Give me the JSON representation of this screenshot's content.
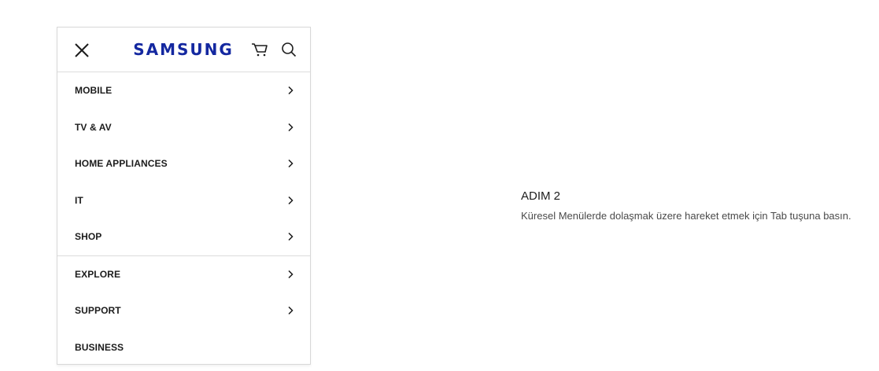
{
  "header": {
    "logo": "SAMSUNG",
    "close_icon": "close-icon",
    "cart_icon": "cart-icon",
    "search_icon": "search-icon",
    "brand_color": "#1428a0"
  },
  "menu": {
    "primary": [
      {
        "label": "MOBILE",
        "has_submenu": true
      },
      {
        "label": "TV & AV",
        "has_submenu": true
      },
      {
        "label": "HOME APPLIANCES",
        "has_submenu": true
      },
      {
        "label": "IT",
        "has_submenu": true
      },
      {
        "label": "SHOP",
        "has_submenu": true
      }
    ],
    "secondary": [
      {
        "label": "EXPLORE",
        "has_submenu": true
      },
      {
        "label": "SUPPORT",
        "has_submenu": true
      },
      {
        "label": "BUSINESS",
        "has_submenu": false
      }
    ]
  },
  "step": {
    "title": "ADIM 2",
    "description": "Küresel Menülerde dolaşmak üzere hareket etmek için Tab tuşuna basın."
  }
}
